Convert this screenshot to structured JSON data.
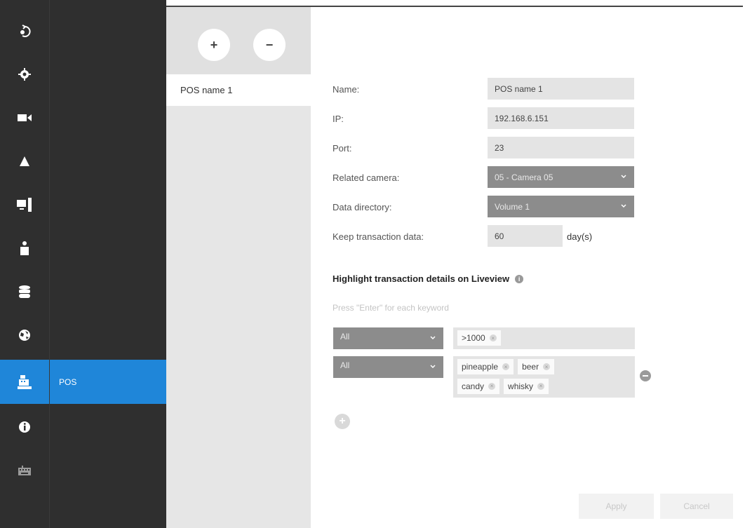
{
  "rail": {
    "items": [
      {
        "icon": "logout-icon"
      },
      {
        "icon": "gear-icon"
      },
      {
        "icon": "camera-icon"
      },
      {
        "icon": "alert-icon"
      },
      {
        "icon": "monitor-icon"
      },
      {
        "icon": "user-icon"
      },
      {
        "icon": "database-icon"
      },
      {
        "icon": "globe-icon"
      },
      {
        "icon": "pos-icon"
      },
      {
        "icon": "info-icon"
      },
      {
        "icon": "keyboard-icon"
      }
    ],
    "active_color": "#1f86d9"
  },
  "subnav": {
    "active_label": "POS"
  },
  "poslist": {
    "add_label": "+",
    "remove_label": "−",
    "items": [
      "POS name 1"
    ]
  },
  "form": {
    "name_label": "Name:",
    "name_value": "POS name 1",
    "ip_label": "IP:",
    "ip_value": "192.168.6.151",
    "port_label": "Port:",
    "port_value": "23",
    "camera_label": "Related camera:",
    "camera_value": "05 - Camera 05",
    "directory_label": "Data directory:",
    "directory_value": "Volume 1",
    "keep_label": "Keep transaction data:",
    "keep_value": "60",
    "keep_unit": "day(s)"
  },
  "highlight": {
    "title": "Highlight transaction details on Liveview",
    "hint": "Press \"Enter\" for each keyword",
    "rules": [
      {
        "scope": "All",
        "keywords": [
          ">1000"
        ]
      },
      {
        "scope": "All",
        "keywords": [
          "pineapple",
          "beer",
          "candy",
          "whisky"
        ]
      }
    ]
  },
  "actions": {
    "apply_label": "Apply",
    "cancel_label": "Cancel"
  }
}
